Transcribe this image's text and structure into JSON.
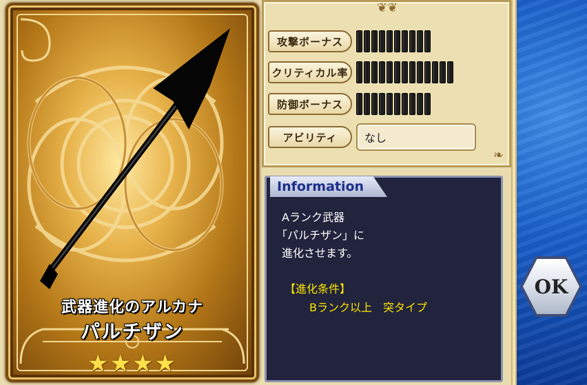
{
  "card": {
    "subtitle": "武器進化のアルカナ",
    "title": "パルチザン",
    "stars": "★★★★",
    "rarity_stars": 4
  },
  "stats": {
    "rows": [
      {
        "label": "攻撃ボーナス",
        "bars": 10
      },
      {
        "label": "クリティカル率",
        "bars": 13
      },
      {
        "label": "防御ボーナス",
        "bars": 10
      }
    ],
    "ability_label": "アビリティ",
    "ability_value": "なし"
  },
  "info": {
    "header": "Information",
    "line1": "Aランク武器",
    "line2": "「パルチザン」に",
    "line3": "進化させます。",
    "cond_header": "【進化条件】",
    "cond_text": "Bランク以上　突タイプ"
  },
  "buttons": {
    "ok_label": "OK"
  },
  "colors": {
    "info_bg": "#21243c",
    "condition_text": "#ffe400",
    "panel_bg": "#ecdfb2",
    "right_bg": "#1a5fc9"
  }
}
